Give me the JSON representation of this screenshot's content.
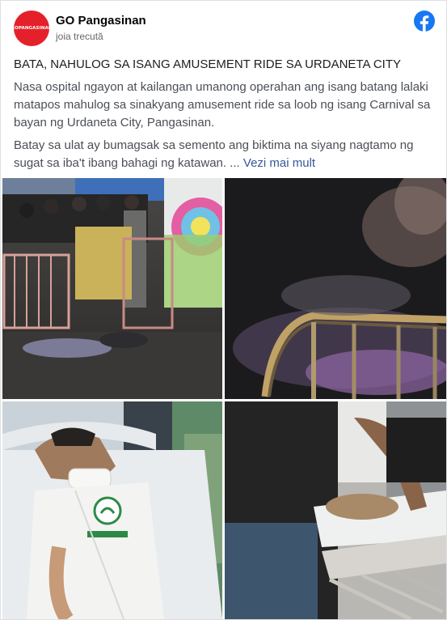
{
  "post": {
    "page_name": "GO Pangasinan",
    "avatar_text": "GOPANGASINAN",
    "timestamp": "joia trecută",
    "platform_icon": "facebook-icon",
    "headline": "BATA, NAHULOG SA ISANG AMUSEMENT RIDE SA URDANETA CITY",
    "paragraph_1": "Nasa ospital ngayon at kailangan umanong operahan ang isang batang lalaki matapos mahulog sa sinakyang amusement ride sa loob ng isang Carnival sa bayan ng Urdaneta City, Pangasinan.",
    "paragraph_2": "Batay sa ulat ay bumagsak sa semento ang biktima na siyang nagtamo ng sugat sa iba't ibang bahagi ng katawan. ...",
    "see_more": "Vezi mai mult"
  },
  "photos": [
    {
      "name": "carnival-scene-photo"
    },
    {
      "name": "blurry-railing-photo"
    },
    {
      "name": "hospital-bed-child-photo"
    },
    {
      "name": "hospital-treatment-photo"
    }
  ],
  "colors": {
    "brand_red": "#e4212b",
    "facebook_blue": "#1877f2",
    "link_blue": "#385898",
    "secondary_text": "#65676b"
  }
}
